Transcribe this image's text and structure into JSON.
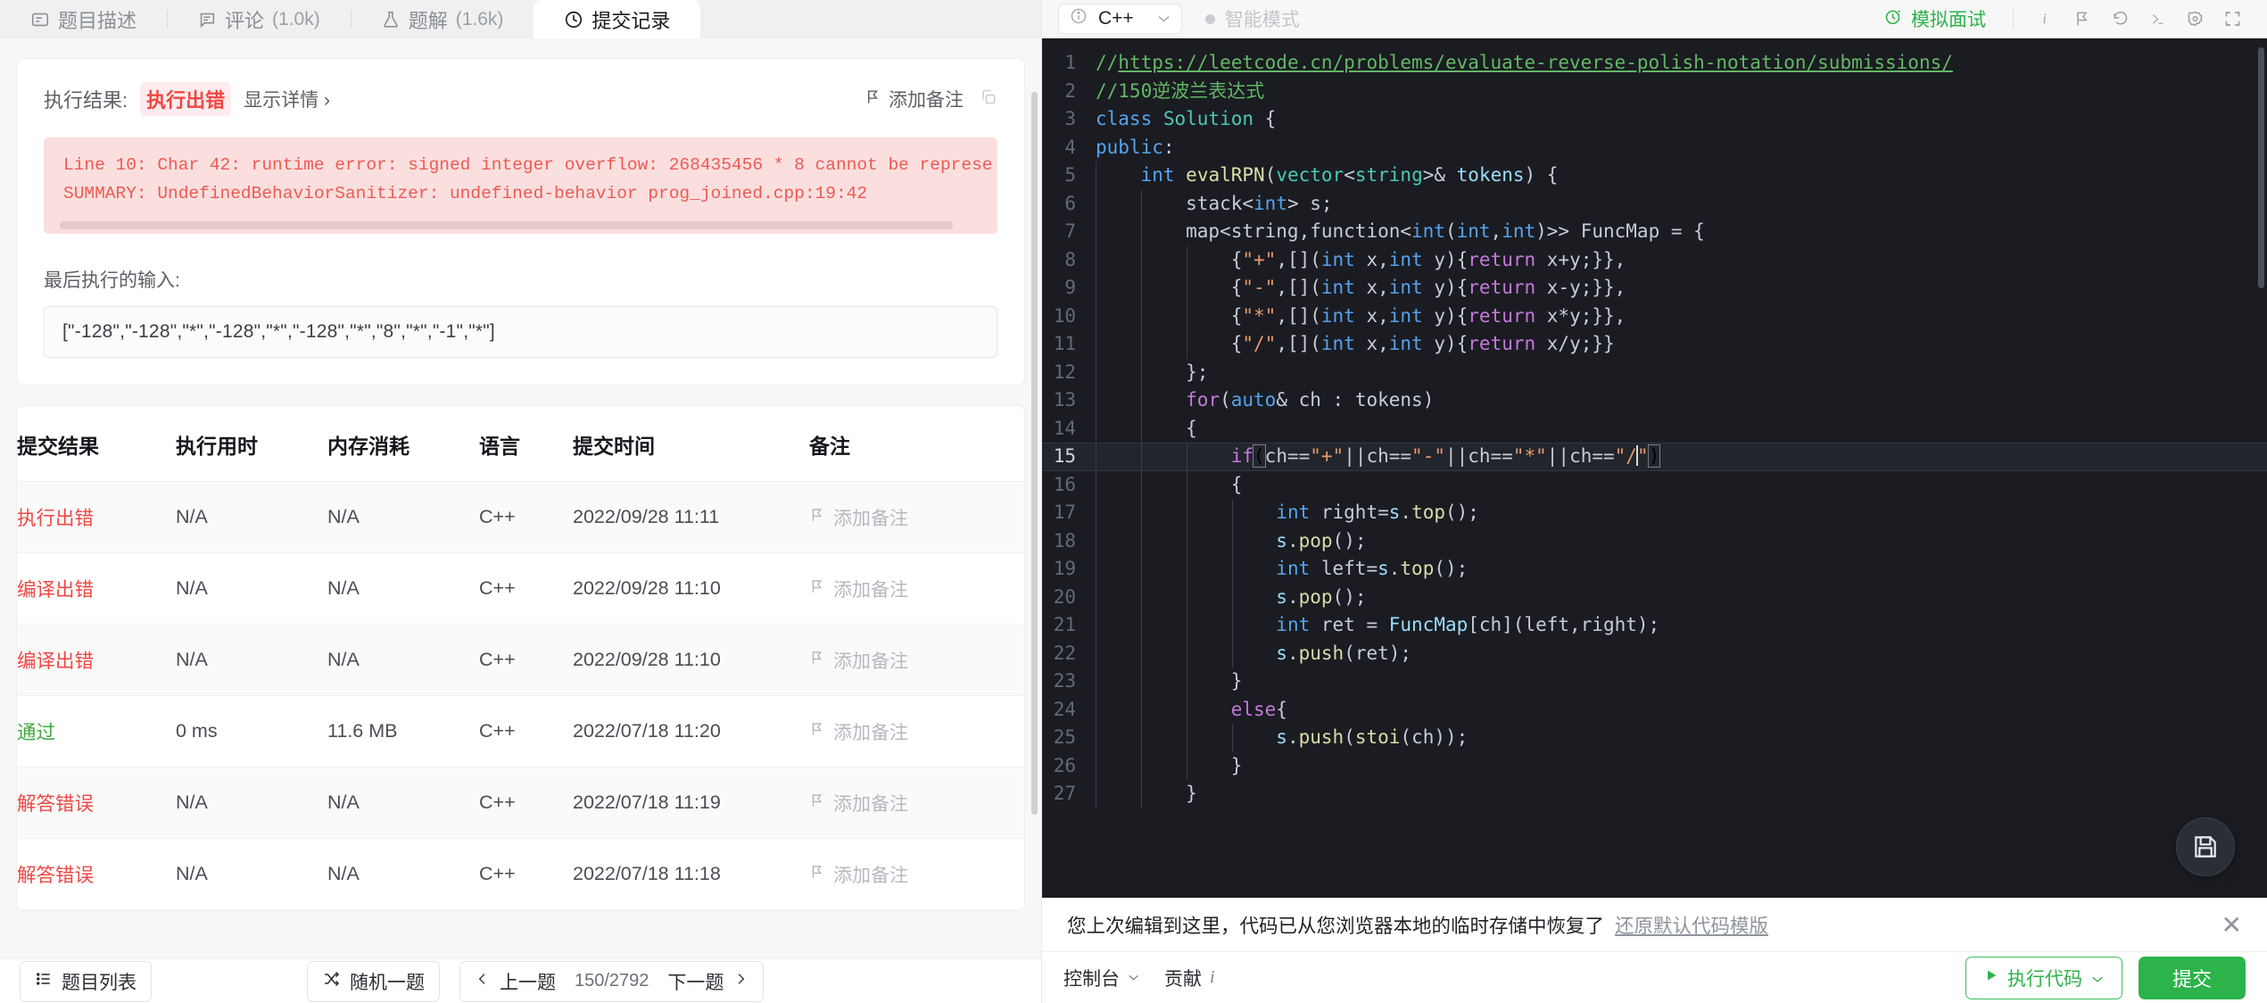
{
  "left": {
    "tabs": [
      {
        "label": "题目描述",
        "count": "",
        "icon": "description-icon",
        "active": false
      },
      {
        "label": "评论",
        "count": "(1.0k)",
        "icon": "comment-icon",
        "active": false
      },
      {
        "label": "题解",
        "count": "(1.6k)",
        "icon": "flask-icon",
        "active": false
      },
      {
        "label": "提交记录",
        "count": "",
        "icon": "clock-icon",
        "active": true
      }
    ],
    "result": {
      "label": "执行结果:",
      "status": "执行出错",
      "detail_link": "显示详情 ›",
      "add_note": "添加备注",
      "error_lines": [
        "Line 10: Char 42: runtime error: signed integer overflow: 268435456 * 8 cannot be represe",
        "SUMMARY: UndefinedBehaviorSanitizer: undefined-behavior prog_joined.cpp:19:42"
      ],
      "input_label": "最后执行的输入:",
      "input_value": "[\"-128\",\"-128\",\"*\",\"-128\",\"*\",\"-128\",\"*\",\"8\",\"*\",\"-1\",\"*\"]"
    },
    "table": {
      "headers": [
        "提交结果",
        "执行用时",
        "内存消耗",
        "语言",
        "提交时间",
        "备注"
      ],
      "note_label": "添加备注",
      "rows": [
        {
          "status": "执行出错",
          "status_type": "fail",
          "time": "N/A",
          "memory": "N/A",
          "lang": "C++",
          "submitted": "2022/09/28 11:11"
        },
        {
          "status": "编译出错",
          "status_type": "fail",
          "time": "N/A",
          "memory": "N/A",
          "lang": "C++",
          "submitted": "2022/09/28 11:10"
        },
        {
          "status": "编译出错",
          "status_type": "fail",
          "time": "N/A",
          "memory": "N/A",
          "lang": "C++",
          "submitted": "2022/09/28 11:10"
        },
        {
          "status": "通过",
          "status_type": "pass",
          "time": "0 ms",
          "memory": "11.6 MB",
          "lang": "C++",
          "submitted": "2022/07/18 11:20"
        },
        {
          "status": "解答错误",
          "status_type": "fail",
          "time": "N/A",
          "memory": "N/A",
          "lang": "C++",
          "submitted": "2022/07/18 11:19"
        },
        {
          "status": "解答错误",
          "status_type": "fail",
          "time": "N/A",
          "memory": "N/A",
          "lang": "C++",
          "submitted": "2022/07/18 11:18"
        }
      ]
    },
    "footer": {
      "problem_list": "题目列表",
      "random": "随机一题",
      "prev": "上一题",
      "counter": "150/2792",
      "next": "下一题"
    }
  },
  "editor": {
    "language": "C++",
    "smart_mode": "智能模式",
    "mock_interview": "模拟面试",
    "toolbar_icons": [
      "info-icon",
      "flag-icon",
      "reset-icon",
      "console-icon",
      "settings-icon",
      "fullscreen-icon"
    ],
    "save_icon": "save-icon",
    "lines": [
      {
        "n": "1",
        "tokens": [
          {
            "t": "//",
            "c": "cmt"
          },
          {
            "t": "https://leetcode.cn/problems/evaluate-reverse-polish-notation/submissions/",
            "c": "cmt-url"
          }
        ]
      },
      {
        "n": "2",
        "tokens": [
          {
            "t": "//150逆波兰表达式",
            "c": "cmt"
          }
        ]
      },
      {
        "n": "3",
        "tokens": [
          {
            "t": "class ",
            "c": "kw2"
          },
          {
            "t": "Solution",
            "c": "typ"
          },
          {
            "t": " {",
            "c": "pl"
          }
        ]
      },
      {
        "n": "4",
        "tokens": [
          {
            "t": "public",
            "c": "kw2"
          },
          {
            "t": ":",
            "c": "pl"
          }
        ]
      },
      {
        "n": "5",
        "indent": 1,
        "tokens": [
          {
            "t": "    ",
            "c": "pl"
          },
          {
            "t": "int",
            "c": "kw2"
          },
          {
            "t": " ",
            "c": "pl"
          },
          {
            "t": "evalRPN",
            "c": "fn"
          },
          {
            "t": "(",
            "c": "pl"
          },
          {
            "t": "vector",
            "c": "typ"
          },
          {
            "t": "<",
            "c": "pl"
          },
          {
            "t": "string",
            "c": "typ"
          },
          {
            "t": ">& ",
            "c": "pl"
          },
          {
            "t": "tokens",
            "c": "var"
          },
          {
            "t": ") {",
            "c": "pl"
          }
        ]
      },
      {
        "n": "6",
        "indent": 2,
        "tokens": [
          {
            "t": "        ",
            "c": "pl"
          },
          {
            "t": "stack",
            "c": "pl"
          },
          {
            "t": "<",
            "c": "pl"
          },
          {
            "t": "int",
            "c": "kw2"
          },
          {
            "t": "> ",
            "c": "pl"
          },
          {
            "t": "s;",
            "c": "pl"
          }
        ]
      },
      {
        "n": "7",
        "indent": 2,
        "tokens": [
          {
            "t": "        map",
            "c": "pl"
          },
          {
            "t": "<string,function<",
            "c": "pl"
          },
          {
            "t": "int",
            "c": "kw2"
          },
          {
            "t": "(",
            "c": "pl"
          },
          {
            "t": "int",
            "c": "kw2"
          },
          {
            "t": ",",
            "c": "pl"
          },
          {
            "t": "int",
            "c": "kw2"
          },
          {
            "t": ")>> FuncMap = {",
            "c": "pl"
          }
        ]
      },
      {
        "n": "8",
        "indent": 3,
        "tokens": [
          {
            "t": "            {",
            "c": "pl"
          },
          {
            "t": "\"+\"",
            "c": "str"
          },
          {
            "t": ",[](",
            "c": "pl"
          },
          {
            "t": "int",
            "c": "kw2"
          },
          {
            "t": " x,",
            "c": "pl"
          },
          {
            "t": "int",
            "c": "kw2"
          },
          {
            "t": " y){",
            "c": "pl"
          },
          {
            "t": "return",
            "c": "kw"
          },
          {
            "t": " x+y;}},",
            "c": "pl"
          }
        ]
      },
      {
        "n": "9",
        "indent": 3,
        "tokens": [
          {
            "t": "            {",
            "c": "pl"
          },
          {
            "t": "\"-\"",
            "c": "str"
          },
          {
            "t": ",[](",
            "c": "pl"
          },
          {
            "t": "int",
            "c": "kw2"
          },
          {
            "t": " x,",
            "c": "pl"
          },
          {
            "t": "int",
            "c": "kw2"
          },
          {
            "t": " y){",
            "c": "pl"
          },
          {
            "t": "return",
            "c": "kw"
          },
          {
            "t": " x-y;}},",
            "c": "pl"
          }
        ]
      },
      {
        "n": "10",
        "indent": 3,
        "tokens": [
          {
            "t": "            {",
            "c": "pl"
          },
          {
            "t": "\"*\"",
            "c": "str"
          },
          {
            "t": ",[](",
            "c": "pl"
          },
          {
            "t": "int",
            "c": "kw2"
          },
          {
            "t": " x,",
            "c": "pl"
          },
          {
            "t": "int",
            "c": "kw2"
          },
          {
            "t": " y){",
            "c": "pl"
          },
          {
            "t": "return",
            "c": "kw"
          },
          {
            "t": " x*y;}},",
            "c": "pl"
          }
        ]
      },
      {
        "n": "11",
        "indent": 3,
        "tokens": [
          {
            "t": "            {",
            "c": "pl"
          },
          {
            "t": "\"/\"",
            "c": "str"
          },
          {
            "t": ",[](",
            "c": "pl"
          },
          {
            "t": "int",
            "c": "kw2"
          },
          {
            "t": " x,",
            "c": "pl"
          },
          {
            "t": "int",
            "c": "kw2"
          },
          {
            "t": " y){",
            "c": "pl"
          },
          {
            "t": "return",
            "c": "kw"
          },
          {
            "t": " x/y;}}",
            "c": "pl"
          }
        ]
      },
      {
        "n": "12",
        "indent": 2,
        "tokens": [
          {
            "t": "        };",
            "c": "pl"
          }
        ]
      },
      {
        "n": "13",
        "indent": 2,
        "tokens": [
          {
            "t": "        ",
            "c": "pl"
          },
          {
            "t": "for",
            "c": "kw"
          },
          {
            "t": "(",
            "c": "pl"
          },
          {
            "t": "auto",
            "c": "kw2"
          },
          {
            "t": "& ch : tokens)",
            "c": "pl"
          }
        ]
      },
      {
        "n": "14",
        "indent": 2,
        "tokens": [
          {
            "t": "        {",
            "c": "pl"
          }
        ]
      },
      {
        "n": "15",
        "indent": 3,
        "current": true,
        "tokens": [
          {
            "t": "            ",
            "c": "pl"
          },
          {
            "t": "if",
            "c": "kw"
          },
          {
            "t": "(",
            "c": "brk"
          },
          {
            "t": "ch==",
            "c": "pl"
          },
          {
            "t": "\"+\"",
            "c": "str"
          },
          {
            "t": "||ch==",
            "c": "pl"
          },
          {
            "t": "\"-\"",
            "c": "str"
          },
          {
            "t": "||ch==",
            "c": "pl"
          },
          {
            "t": "\"*\"",
            "c": "str"
          },
          {
            "t": "||ch==",
            "c": "pl"
          },
          {
            "t": "\"/",
            "c": "str"
          },
          {
            "t": "CARET",
            "c": "caret"
          },
          {
            "t": "\"",
            "c": "str"
          },
          {
            "t": ")",
            "c": "brk"
          }
        ]
      },
      {
        "n": "16",
        "indent": 3,
        "tokens": [
          {
            "t": "            {",
            "c": "pl"
          }
        ]
      },
      {
        "n": "17",
        "indent": 4,
        "tokens": [
          {
            "t": "                ",
            "c": "pl"
          },
          {
            "t": "int",
            "c": "kw2"
          },
          {
            "t": " right=",
            "c": "pl"
          },
          {
            "t": "s",
            "c": "var"
          },
          {
            "t": ".",
            "c": "pl"
          },
          {
            "t": "top",
            "c": "fn"
          },
          {
            "t": "();",
            "c": "pl"
          }
        ]
      },
      {
        "n": "18",
        "indent": 4,
        "tokens": [
          {
            "t": "                ",
            "c": "pl"
          },
          {
            "t": "s",
            "c": "var"
          },
          {
            "t": ".",
            "c": "pl"
          },
          {
            "t": "pop",
            "c": "fn"
          },
          {
            "t": "();",
            "c": "pl"
          }
        ]
      },
      {
        "n": "19",
        "indent": 4,
        "tokens": [
          {
            "t": "                ",
            "c": "pl"
          },
          {
            "t": "int",
            "c": "kw2"
          },
          {
            "t": " left=",
            "c": "pl"
          },
          {
            "t": "s",
            "c": "var"
          },
          {
            "t": ".",
            "c": "pl"
          },
          {
            "t": "top",
            "c": "fn"
          },
          {
            "t": "();",
            "c": "pl"
          }
        ]
      },
      {
        "n": "20",
        "indent": 4,
        "tokens": [
          {
            "t": "                ",
            "c": "pl"
          },
          {
            "t": "s",
            "c": "var"
          },
          {
            "t": ".",
            "c": "pl"
          },
          {
            "t": "pop",
            "c": "fn"
          },
          {
            "t": "();",
            "c": "pl"
          }
        ]
      },
      {
        "n": "21",
        "indent": 4,
        "tokens": [
          {
            "t": "                ",
            "c": "pl"
          },
          {
            "t": "int",
            "c": "kw2"
          },
          {
            "t": " ret = ",
            "c": "pl"
          },
          {
            "t": "FuncMap",
            "c": "var"
          },
          {
            "t": "[ch](left,right);",
            "c": "pl"
          }
        ]
      },
      {
        "n": "22",
        "indent": 4,
        "tokens": [
          {
            "t": "                ",
            "c": "pl"
          },
          {
            "t": "s",
            "c": "var"
          },
          {
            "t": ".",
            "c": "pl"
          },
          {
            "t": "push",
            "c": "fn"
          },
          {
            "t": "(ret);",
            "c": "pl"
          }
        ]
      },
      {
        "n": "23",
        "indent": 3,
        "tokens": [
          {
            "t": "            }",
            "c": "pl"
          }
        ]
      },
      {
        "n": "24",
        "indent": 3,
        "tokens": [
          {
            "t": "            ",
            "c": "pl"
          },
          {
            "t": "else",
            "c": "kw"
          },
          {
            "t": "{",
            "c": "pl"
          }
        ]
      },
      {
        "n": "25",
        "indent": 4,
        "tokens": [
          {
            "t": "                ",
            "c": "pl"
          },
          {
            "t": "s",
            "c": "var"
          },
          {
            "t": ".",
            "c": "pl"
          },
          {
            "t": "push",
            "c": "fn"
          },
          {
            "t": "(",
            "c": "pl"
          },
          {
            "t": "stoi",
            "c": "fn"
          },
          {
            "t": "(ch));",
            "c": "pl"
          }
        ]
      },
      {
        "n": "26",
        "indent": 3,
        "tokens": [
          {
            "t": "            }",
            "c": "pl"
          }
        ]
      },
      {
        "n": "27",
        "indent": 2,
        "tokens": [
          {
            "t": "        }",
            "c": "pl"
          }
        ]
      }
    ]
  },
  "notice": {
    "text": "您上次编辑到这里，代码已从您浏览器本地的临时存储中恢复了",
    "link": "还原默认代码模版",
    "close": "✕"
  },
  "bottom": {
    "console": "控制台",
    "contribute": "贡献",
    "run": "执行代码",
    "submit": "提交"
  }
}
